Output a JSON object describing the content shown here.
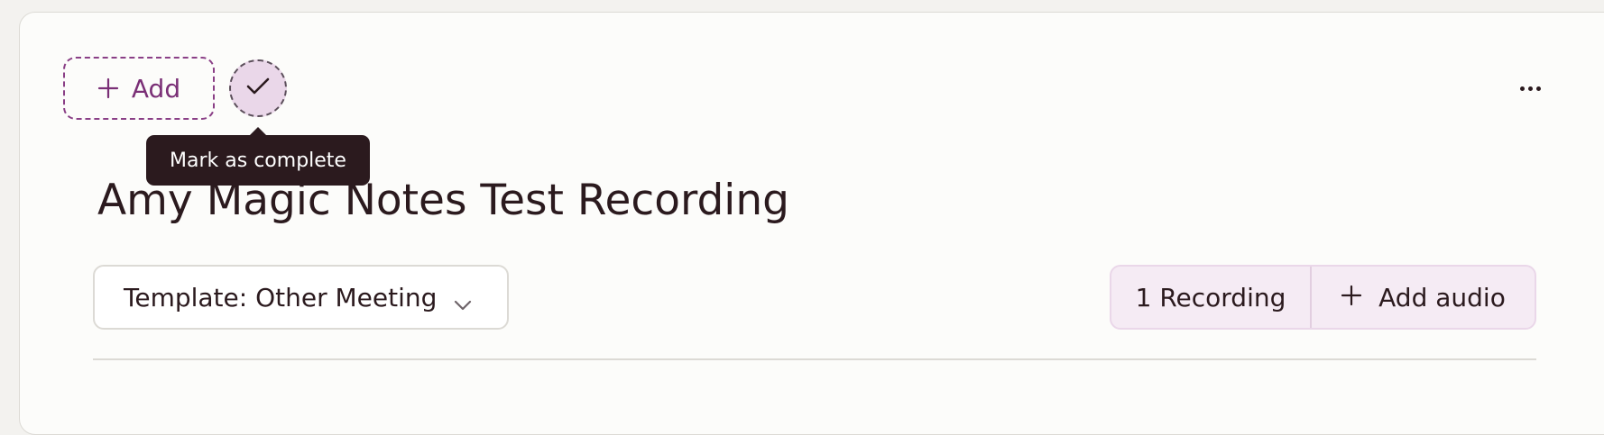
{
  "toolbar": {
    "add_label": "Add",
    "complete_tooltip": "Mark as complete"
  },
  "note": {
    "title": "Amy Magic Notes Test Recording"
  },
  "template_select": {
    "value": "Template: Other Meeting"
  },
  "recordings": {
    "count_label": "1 Recording",
    "add_audio_label": "Add audio"
  },
  "icons": {
    "add": "plus-icon",
    "complete": "checkmark-icon",
    "more": "more-horizontal-icon",
    "chevron": "chevron-down-icon",
    "add_audio": "plus-icon"
  },
  "colors": {
    "accent": "#7a2f76",
    "tooltip_bg": "#2b1a1e",
    "complete_bg": "#ead7e9",
    "recording_bg": "#f5ebf4",
    "text": "#2b1a1e"
  }
}
